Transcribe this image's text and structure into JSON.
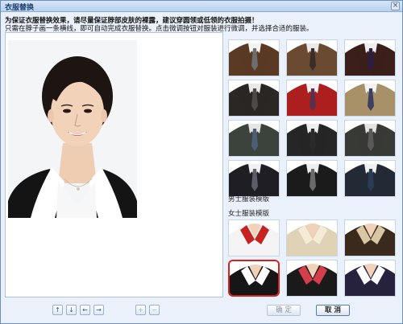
{
  "window": {
    "title": "衣服替换",
    "close_glyph": "×"
  },
  "instructions": {
    "line1": "为保证衣服替换效果，请尽量保证脖部皮肤的裸露，建议穿圆领或低领的衣服拍摄！",
    "line2": "只需在脖子画一条横线，即可自动完成衣服替换。点击微调按钮对服装进行微调，并选择合适的服装。"
  },
  "templates": {
    "male_title": "男士服装模版",
    "female_title": "女士服装模版",
    "male": [
      {
        "suit": "#5a3a25",
        "shirt": "#f3f3f3",
        "tie": "#6d6d6d"
      },
      {
        "suit": "#6b4a32",
        "shirt": "#e9e9e9",
        "tie": "#3a2d27"
      },
      {
        "suit": "#3b1f1a",
        "shirt": "#eeeeee",
        "tie": "#2c1e40"
      },
      {
        "suit": "#2a2725",
        "shirt": "#e9e9e9",
        "tie": "#4a4a4a"
      },
      {
        "suit": "#ad1f1f",
        "shirt": "#f2f2f2",
        "tie": "#5a2f4b"
      },
      {
        "suit": "#a89069",
        "shirt": "#f2f2f2",
        "tie": "#3d3f63"
      },
      {
        "suit": "#3c423c",
        "shirt": "#e6e6e6",
        "tie": "#4d5d74"
      },
      {
        "suit": "#262626",
        "shirt": "#eeeeee",
        "tie": "#2a2a2a"
      },
      {
        "suit": "#383a36",
        "shirt": "#e3e3e3",
        "tie": "#5a5a5a"
      },
      {
        "suit": "#1e1e24",
        "shirt": "#f0f0f0",
        "tie": "#5d5d68"
      },
      {
        "suit": "#1b1b1b",
        "shirt": "#eeeeee",
        "tie": "#6a6a6a"
      },
      {
        "suit": "#222a35",
        "shirt": "#f0f0f0",
        "tie": "#2b3a55"
      }
    ],
    "female": [
      {
        "suit": "#f4f4f4",
        "collar": "#c72222"
      },
      {
        "suit": "#e0d2b6",
        "collar": "#f5ecd8"
      },
      {
        "suit": "#3a2a1e",
        "collar": "#d8c7a2"
      },
      {
        "suit": "#161616",
        "collar": "#ffffff"
      },
      {
        "suit": "#1a1a1a",
        "collar": "#d43d4a"
      },
      {
        "suit": "#26213d",
        "collar": "#ffffff"
      }
    ],
    "selected_female_index": 3
  },
  "toolbar": {
    "tool_icons": [
      "↑",
      "↓",
      "←",
      "→",
      "+",
      "−"
    ],
    "confirm_label": "确 定",
    "cancel_label": "取 消"
  },
  "colors": {
    "accent": "#4b7bc0",
    "selected_border": "#d62020"
  }
}
